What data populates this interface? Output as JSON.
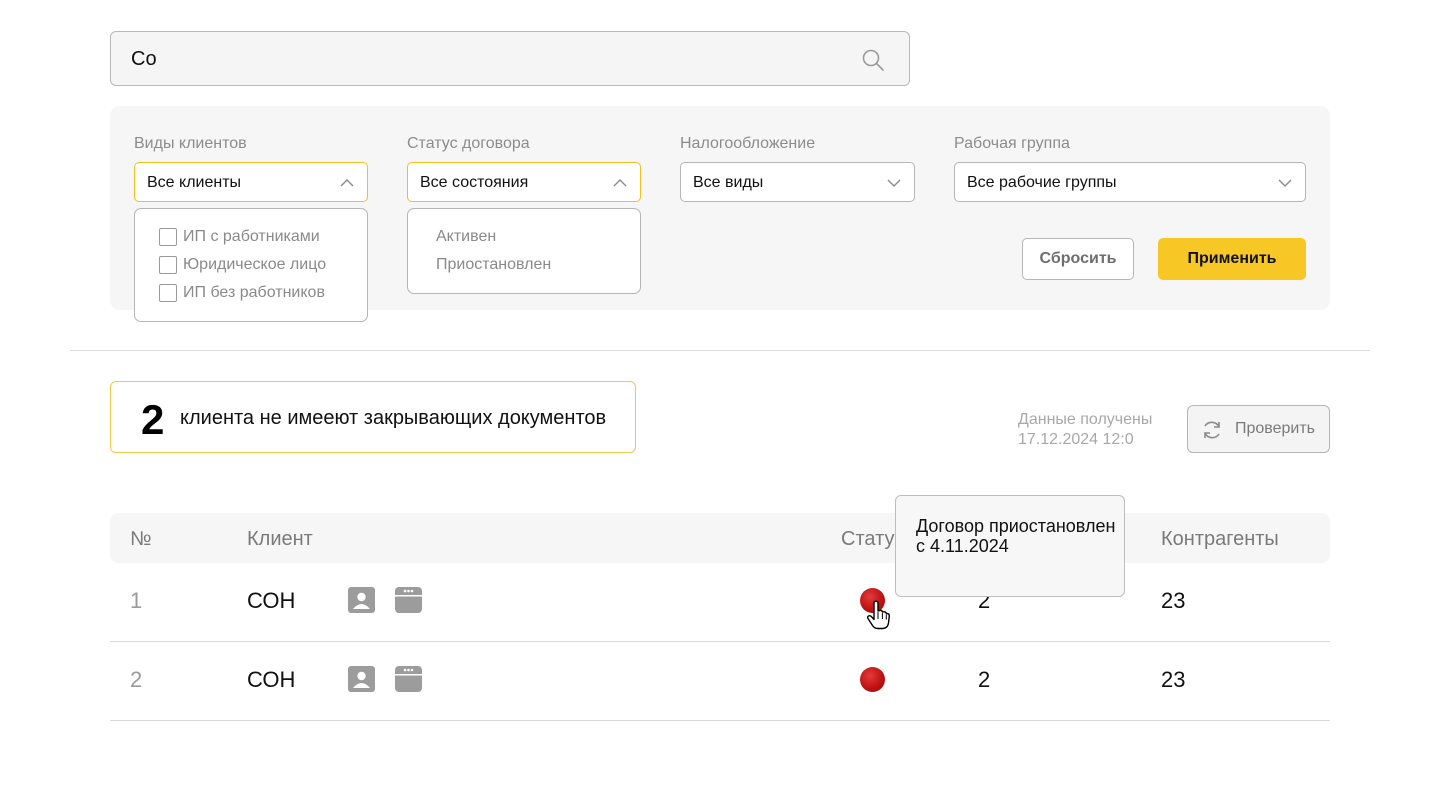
{
  "search": {
    "value": "Co",
    "icon": "search-icon"
  },
  "filters": {
    "client_types": {
      "label": "Виды клиентов",
      "value": "Все клиенты",
      "options": [
        "ИП с работниками",
        "Юридическое лицо",
        "ИП без работников"
      ]
    },
    "contract_status": {
      "label": "Статус договора",
      "value": "Все состояния",
      "options": [
        "Активен",
        "Приостановлен"
      ]
    },
    "taxation": {
      "label": "Налогообложение",
      "value": "Все виды"
    },
    "work_group": {
      "label": "Рабочая группа",
      "value": "Все рабочие группы"
    },
    "reset_label": "Сбросить",
    "apply_label": "Применить",
    "apply_color": "#f7c825"
  },
  "alert": {
    "count": "2",
    "text": "клиента не имееют закрывающих документов"
  },
  "updated": {
    "line1": "Данные получены",
    "line2": "17.12.2024 12:0"
  },
  "check_label": "Проверить",
  "table": {
    "headers": {
      "num": "№",
      "client": "Клиент",
      "status": "Статус",
      "counterparties": "Контрагенты"
    },
    "rows": [
      {
        "num": "1",
        "client": "СОН",
        "status": "suspended",
        "status_color": "#c01212",
        "col4": "2",
        "counterparties": "23"
      },
      {
        "num": "2",
        "client": "СОН",
        "status": "suspended",
        "status_color": "#c01212",
        "col4": "2",
        "counterparties": "23"
      }
    ]
  },
  "tooltip": {
    "text": "Договор приостановлен с 4.11.2024"
  }
}
